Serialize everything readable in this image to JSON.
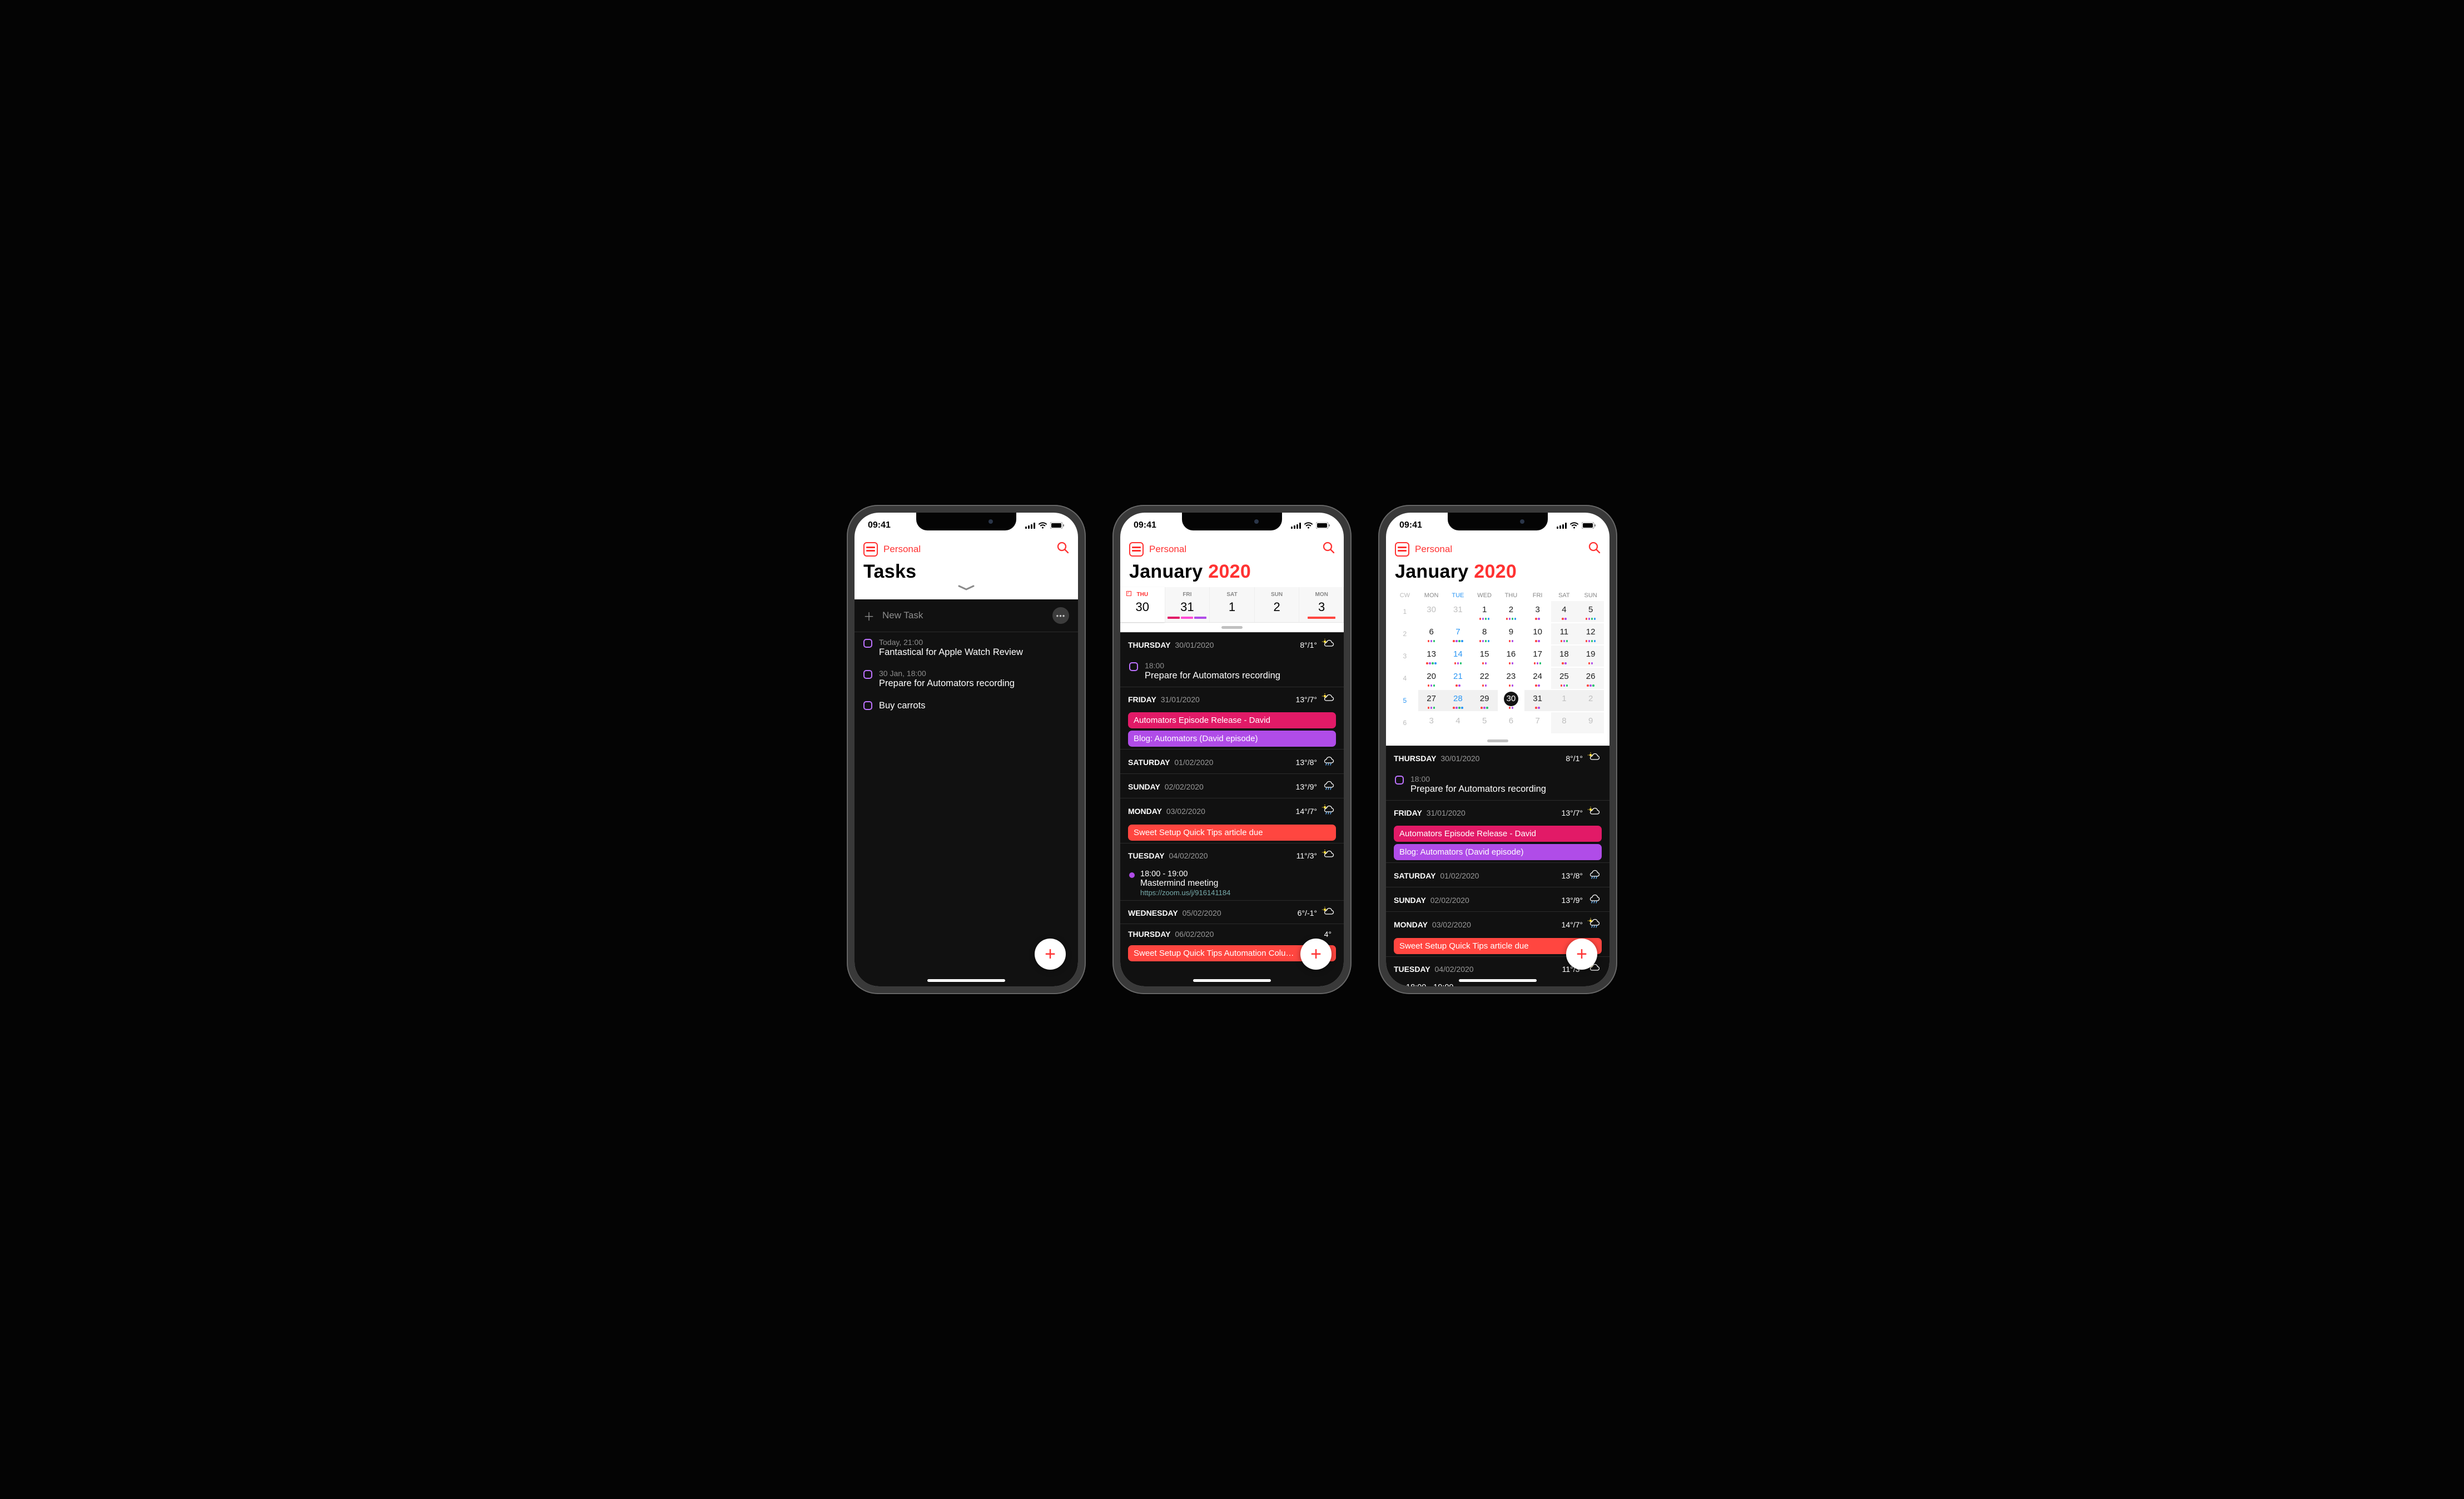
{
  "common": {
    "time": "09:41",
    "calendar_set": "Personal",
    "fab_plus": "+"
  },
  "tasks_view": {
    "title": "Tasks",
    "new_task": "New Task",
    "items": [
      {
        "time": "Today, 21:00",
        "title": "Fantastical for Apple Watch Review"
      },
      {
        "time": "30 Jan, 18:00",
        "title": "Prepare for Automators recording"
      },
      {
        "time": "",
        "title": "Buy carrots"
      }
    ]
  },
  "week_view": {
    "month": "January",
    "year": "2020",
    "days": [
      {
        "dow": "THU",
        "date": "30",
        "today": true,
        "selected": true
      },
      {
        "dow": "FRI",
        "date": "31"
      },
      {
        "dow": "SAT",
        "date": "1"
      },
      {
        "dow": "SUN",
        "date": "2"
      },
      {
        "dow": "MON",
        "date": "3"
      }
    ]
  },
  "month_view": {
    "month": "January",
    "year": "2020",
    "head": [
      "CW",
      "MON",
      "TUE",
      "WED",
      "THU",
      "FRI",
      "SAT",
      "SUN"
    ],
    "cw": [
      "1",
      "2",
      "3",
      "4",
      "5",
      "6"
    ],
    "rows": [
      [
        {
          "n": "30",
          "o": true
        },
        {
          "n": "31",
          "o": true
        },
        {
          "n": "1"
        },
        {
          "n": "2"
        },
        {
          "n": "3"
        },
        {
          "n": "4",
          "w": true
        },
        {
          "n": "5",
          "w": true
        }
      ],
      [
        {
          "n": "6"
        },
        {
          "n": "7"
        },
        {
          "n": "8"
        },
        {
          "n": "9"
        },
        {
          "n": "10"
        },
        {
          "n": "11",
          "w": true
        },
        {
          "n": "12",
          "w": true
        }
      ],
      [
        {
          "n": "13"
        },
        {
          "n": "14"
        },
        {
          "n": "15"
        },
        {
          "n": "16"
        },
        {
          "n": "17"
        },
        {
          "n": "18",
          "w": true
        },
        {
          "n": "19",
          "w": true
        }
      ],
      [
        {
          "n": "20"
        },
        {
          "n": "21"
        },
        {
          "n": "22"
        },
        {
          "n": "23"
        },
        {
          "n": "24"
        },
        {
          "n": "25",
          "w": true
        },
        {
          "n": "26",
          "w": true
        }
      ],
      [
        {
          "n": "27"
        },
        {
          "n": "28"
        },
        {
          "n": "29"
        },
        {
          "n": "30",
          "t": true
        },
        {
          "n": "31"
        },
        {
          "n": "1",
          "o": true,
          "w": true
        },
        {
          "n": "2",
          "o": true,
          "w": true
        }
      ],
      [
        {
          "n": "3",
          "o": true
        },
        {
          "n": "4",
          "o": true
        },
        {
          "n": "5",
          "o": true
        },
        {
          "n": "6",
          "o": true
        },
        {
          "n": "7",
          "o": true
        },
        {
          "n": "8",
          "o": true,
          "w": true
        },
        {
          "n": "9",
          "o": true,
          "w": true
        }
      ]
    ]
  },
  "agenda": {
    "sections": [
      {
        "dow": "THURSDAY",
        "date": "30/01/2020",
        "temp": "8°/1°",
        "icon": "partly-cloudy",
        "items": [
          {
            "type": "task",
            "time": "18:00",
            "title": "Prepare for Automators recording"
          }
        ]
      },
      {
        "dow": "FRIDAY",
        "date": "31/01/2020",
        "temp": "13°/7°",
        "icon": "partly-cloudy",
        "items": [
          {
            "type": "pill",
            "color": "#e21a67",
            "title": "Automators Episode Release - David"
          },
          {
            "type": "pill",
            "color": "#b04ce8",
            "title": "Blog: Automators (David episode)"
          }
        ]
      },
      {
        "dow": "SATURDAY",
        "date": "01/02/2020",
        "temp": "13°/8°",
        "icon": "rain",
        "items": []
      },
      {
        "dow": "SUNDAY",
        "date": "02/02/2020",
        "temp": "13°/9°",
        "icon": "rain-cloud",
        "items": []
      },
      {
        "dow": "MONDAY",
        "date": "03/02/2020",
        "temp": "14°/7°",
        "icon": "partly-sunny-rain",
        "items": [
          {
            "type": "pill",
            "color": "#ff4640",
            "title": "Sweet Setup Quick Tips article due"
          }
        ]
      },
      {
        "dow": "TUESDAY",
        "date": "04/02/2020",
        "temp": "11°/3°",
        "icon": "partly-cloudy",
        "items": [
          {
            "type": "event",
            "dotcolor": "#b04ce8",
            "time": "18:00 - 19:00",
            "title": "Mastermind meeting",
            "link": "https://zoom.us/j/916141184"
          }
        ]
      },
      {
        "dow": "WEDNESDAY",
        "date": "05/02/2020",
        "temp": "6°/-1°",
        "icon": "partly-cloudy",
        "items": []
      },
      {
        "dow": "THURSDAY",
        "date": "06/02/2020",
        "temp": "4°",
        "icon": "",
        "items": [
          {
            "type": "pill",
            "color": "#ff4640",
            "title": "Sweet Setup Quick Tips Automation Colu…"
          }
        ]
      }
    ]
  }
}
